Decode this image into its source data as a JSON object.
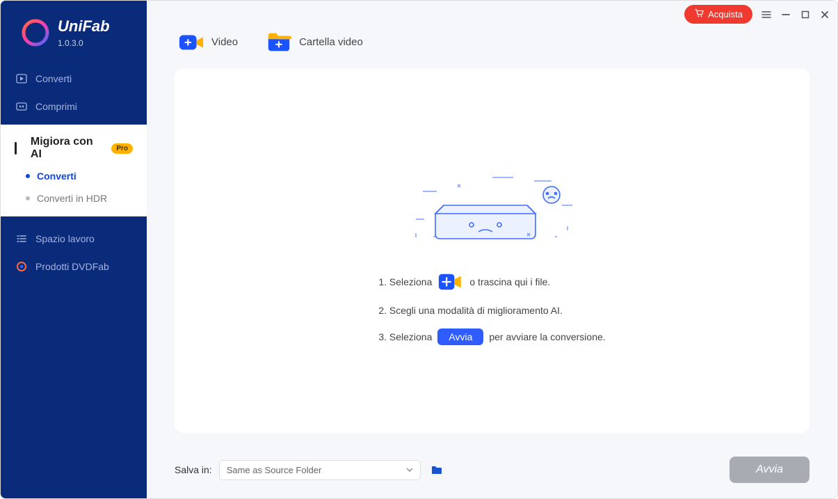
{
  "app": {
    "name": "UniFab",
    "version": "1.0.3.0"
  },
  "titlebar": {
    "buy": "Acquista"
  },
  "sidebar": {
    "items": [
      {
        "label": "Converti"
      },
      {
        "label": "Comprimi"
      }
    ],
    "active": {
      "label": "Migiora con AI",
      "badge": "Pro"
    },
    "sub": [
      {
        "label": "Converti"
      },
      {
        "label": "Converti in HDR"
      }
    ],
    "lower": [
      {
        "label": "Spazio lavoro"
      },
      {
        "label": "Prodotti DVDFab"
      }
    ]
  },
  "toolbar": {
    "video": "Video",
    "folder": "Cartella video"
  },
  "steps": {
    "s1a": "1. Seleziona",
    "s1b": "o trascina qui i file.",
    "s2": "2. Scegli una modalità di miglioramento AI.",
    "s3a": "3. Seleziona",
    "s3chip": "Avvia",
    "s3b": "per avviare la conversione."
  },
  "footer": {
    "label": "Salva in:",
    "path": "Same as Source Folder",
    "start": "Avvia"
  }
}
